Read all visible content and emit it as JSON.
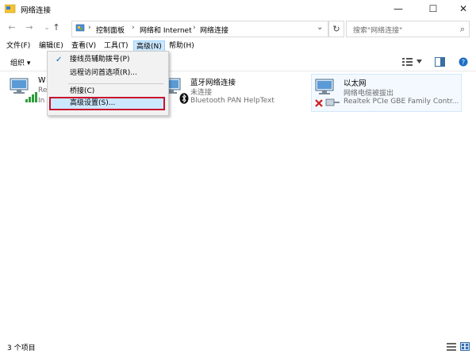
{
  "window": {
    "title": "网络连接",
    "minimize": "—",
    "maximize": "☐",
    "close": "✕"
  },
  "navigation": {
    "back": "←",
    "forward": "→",
    "up": "↑",
    "breadcrumbs": [
      "控制面板",
      "网络和 Internet",
      "网络连接"
    ],
    "separator": "›",
    "dropdown_arrow": "⌄",
    "refresh": "↻",
    "search_placeholder": "搜索\"网络连接\"",
    "search_icon": "⌕"
  },
  "menubar": {
    "items": [
      "文件(F)",
      "编辑(E)",
      "查看(V)",
      "工具(T)",
      "高级(N)",
      "帮助(H)"
    ]
  },
  "toolbar": {
    "organize_label": "组织 ▾"
  },
  "dropdown": {
    "check": "✓",
    "items": [
      "接线员辅助拨号(P)",
      "远程访问首选项(R)...",
      "桥接(C)",
      "高级设置(S)..."
    ]
  },
  "connections": [
    {
      "name_visible": "W",
      "status_visible": "Re",
      "device_visible": "In"
    },
    {
      "name": "蓝牙网络连接",
      "status": "未连接",
      "device": "Bluetooth PAN HelpText"
    },
    {
      "name": "以太网",
      "status": "网络电缆被拔出",
      "device": "Realtek PCIe GBE Family Contr..."
    }
  ],
  "statusbar": {
    "count": "3 个项目"
  },
  "colors": {
    "accent": "#0063b1",
    "menu_highlight": "#cce8ff",
    "annotation_box": "#c8102e",
    "wifi_bars": "#2e9d3a",
    "error_x": "#d11f1f"
  }
}
